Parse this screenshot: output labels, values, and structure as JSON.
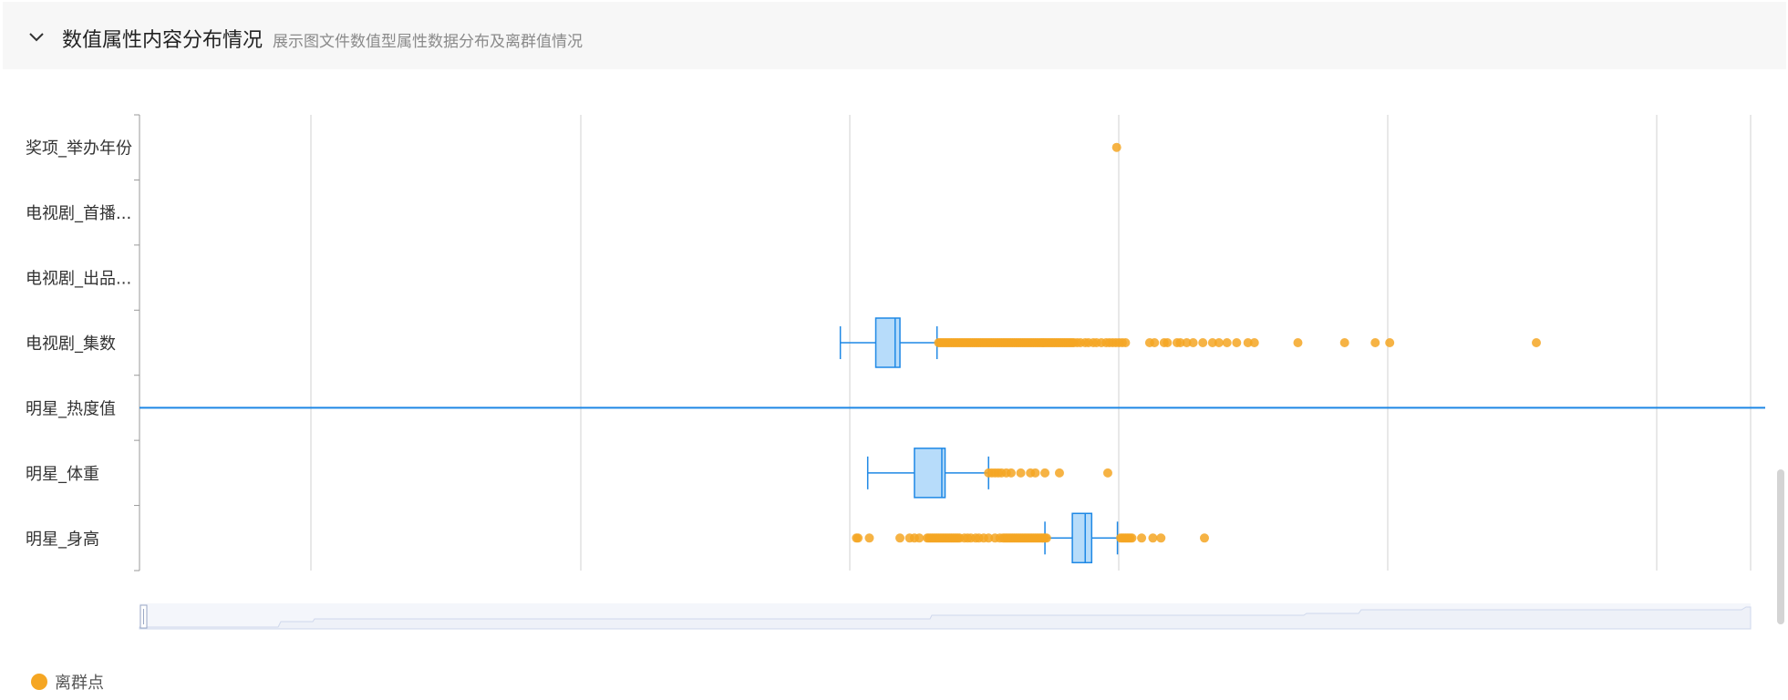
{
  "section": {
    "title": "数值属性内容分布情况",
    "subtitle": "展示图文件数值型属性数据分布及离群值情况",
    "collapse_icon": "chevron-down-icon"
  },
  "legend": {
    "label": "离群点",
    "color": "#f5a623"
  },
  "colors": {
    "outlier": "#f5a623",
    "box_fill": "#b7dcfa",
    "box_stroke": "#1e88e5",
    "grid": "#d0d0d0",
    "highlight_line": "#1e88e5",
    "axis_label": "#333333"
  },
  "chart_data": {
    "type": "boxplot",
    "orientation": "horizontal",
    "x_axis_labels_visible": false,
    "grid": true,
    "dataZoom_slider": true,
    "xlim": [
      0,
      1000
    ],
    "categories": [
      "奖项_举办年份",
      "电视剧_首播...",
      "电视剧_出品...",
      "电视剧_集数",
      "明星_热度值",
      "明星_体重",
      "明星_身高"
    ],
    "highlighted_category": "明星_热度值",
    "boxes": [
      null,
      null,
      null,
      {
        "min": 435,
        "q1": 457,
        "median": 469,
        "q3": 472,
        "max": 495
      },
      null,
      {
        "min": 452,
        "q1": 481,
        "median": 498,
        "q3": 500,
        "max": 527
      },
      {
        "min": 562,
        "q1": 579,
        "median": 587,
        "q3": 591,
        "max": 607
      }
    ],
    "outliers": [
      [
        606.5
      ],
      [],
      [],
      [
        496,
        497,
        498,
        499,
        500,
        501,
        502,
        503,
        504,
        505,
        506,
        507,
        508,
        509,
        510,
        511,
        512,
        513,
        514,
        515,
        516,
        517,
        518,
        519,
        520,
        521,
        522,
        523,
        524,
        525,
        526,
        527,
        528,
        529,
        530,
        531,
        532,
        533,
        534,
        535,
        536,
        537,
        538,
        539,
        540,
        541,
        542,
        543,
        544,
        545,
        546,
        547,
        548,
        549,
        550,
        551,
        552,
        553,
        554,
        555,
        556,
        557,
        558,
        559,
        560,
        561,
        562,
        563,
        564,
        565,
        566,
        567,
        568,
        569,
        570,
        571,
        572,
        573,
        574,
        575,
        576,
        577,
        578,
        579,
        580,
        582,
        584,
        587,
        589,
        592,
        594,
        597,
        600,
        602,
        604,
        606,
        608,
        610,
        612,
        627,
        630,
        636,
        638,
        644,
        646,
        650,
        654,
        660,
        666,
        670,
        675,
        681,
        688,
        692,
        719,
        748,
        767,
        776,
        867
      ],
      [],
      [
        527,
        529,
        531,
        533,
        535,
        538,
        541,
        547,
        553,
        556,
        562,
        571,
        601
      ],
      [
        445,
        446,
        453,
        472,
        478,
        481,
        484,
        489,
        490,
        491,
        492,
        493,
        494,
        495,
        496,
        497,
        498,
        499,
        500,
        501,
        502,
        503,
        504,
        505,
        506,
        507,
        508,
        509,
        512,
        514,
        516,
        519,
        521,
        524,
        527,
        531,
        534,
        536,
        537,
        538,
        539,
        540,
        541,
        542,
        543,
        544,
        545,
        546,
        547,
        548,
        549,
        550,
        551,
        552,
        553,
        554,
        555,
        556,
        557,
        558,
        559,
        560,
        561,
        562,
        563,
        609,
        610,
        611,
        612,
        613,
        614,
        615,
        616,
        622,
        629,
        634,
        661
      ]
    ]
  }
}
